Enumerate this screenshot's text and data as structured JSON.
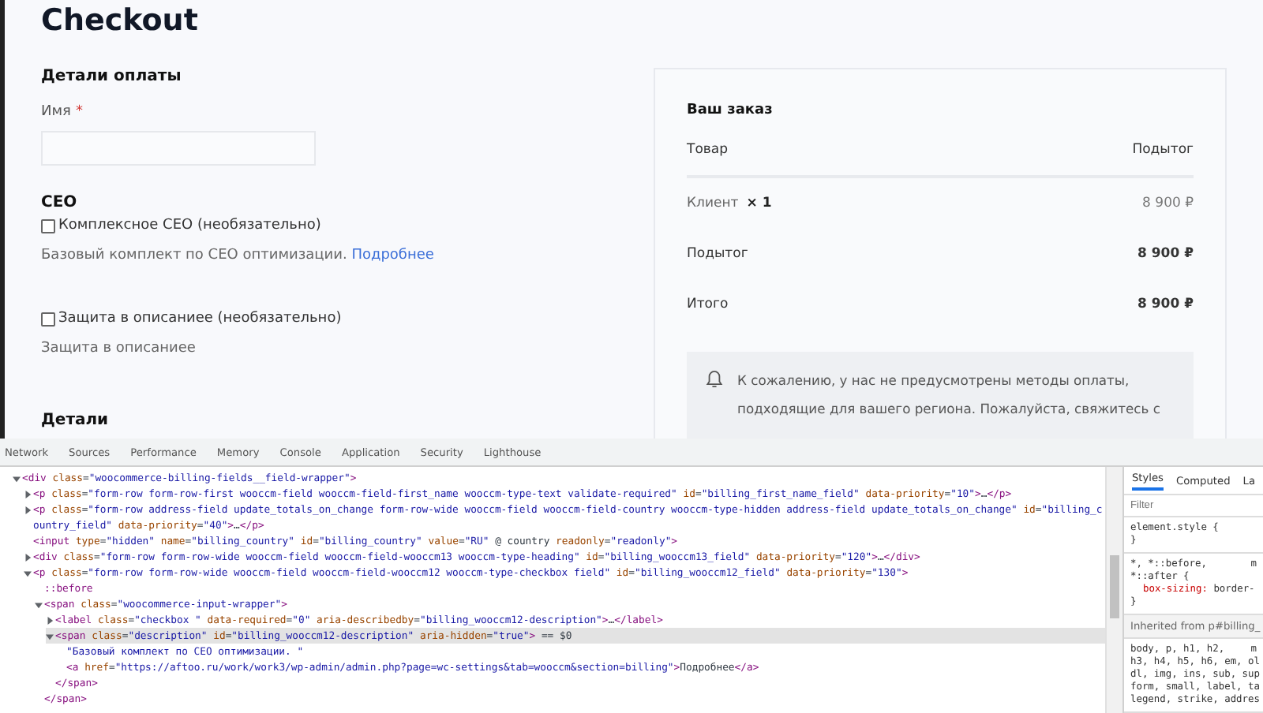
{
  "page": {
    "title": "Checkout",
    "billing": {
      "heading": "Детали оплаты",
      "name_field": {
        "label": "Имя",
        "required_mark": "*"
      },
      "seo_heading": "СЕО",
      "options": [
        {
          "label": "Комплексное СЕО (необязательно)",
          "checked": false,
          "description": "Базовый комплект по СЕО оптимизации.",
          "link": "Подробнее"
        },
        {
          "label": "Защита в описаниее (необязательно)",
          "checked": false,
          "description": "Защита в описаниее"
        }
      ],
      "details_heading": "Детали"
    },
    "order": {
      "heading": "Ваш заказ",
      "columns": [
        "Товар",
        "Подытог"
      ],
      "items": [
        {
          "name": "Клиент",
          "quantity": "× 1",
          "total": "8 900 ₽"
        }
      ],
      "totals": [
        {
          "label": "Подытог",
          "value": "8 900 ₽"
        },
        {
          "label": "Итого",
          "value": "8 900 ₽"
        }
      ],
      "notice": "К сожалению, у нас не предусмотрены методы оплаты, подходящие для вашего региона. Пожалуйста, свяжитесь с"
    }
  },
  "devtools": {
    "tabs": [
      {
        "label": "Network",
        "selected": false
      },
      {
        "label": "Sources",
        "selected": false
      },
      {
        "label": "Performance",
        "selected": false
      },
      {
        "label": "Memory",
        "selected": false
      },
      {
        "label": "Console",
        "selected": false
      },
      {
        "label": "Application",
        "selected": false
      },
      {
        "label": "Security",
        "selected": false
      },
      {
        "label": "Lighthouse",
        "selected": false
      }
    ],
    "elements": [
      {
        "kind": "node",
        "expanded": true,
        "selected": false,
        "text": "<div class=\"woocommerce-billing-fields__field-wrapper\">",
        "children": [
          {
            "kind": "node",
            "expanded": false,
            "selected": false,
            "text": "<p class=\"form-row form-row-first wooccm-field wooccm-field-first_name wooccm-type-text validate-required\" id=\"billing_first_name_field\" data-priority=\"10\">…</p>"
          },
          {
            "kind": "node",
            "expanded": false,
            "selected": false,
            "text": "<p class=\"form-row address-field update_totals_on_change form-row-wide wooccm-field wooccm-field-country wooccm-type-hidden address-field update_totals_on_change\" id=\"billing_country_field\" data-priority=\"40\">…</p>"
          },
          {
            "kind": "line",
            "selected": false,
            "text": "<input type=\"hidden\" name=\"billing_country\" id=\"billing_country\" value=\"RU\" @ country readonly=\"readonly\">"
          },
          {
            "kind": "node",
            "expanded": false,
            "selected": false,
            "text": "<div class=\"form-row form-row-wide wooccm-field wooccm-field-wooccm13 wooccm-type-heading\" id=\"billing_wooccm13_field\" data-priority=\"120\">…</div>"
          },
          {
            "kind": "node",
            "expanded": true,
            "selected": false,
            "text": "<p class=\"form-row form-row-wide wooccm-field wooccm-field-wooccm12 wooccm-type-checkbox field\" id=\"billing_wooccm12_field\" data-priority=\"130\">",
            "children": [
              {
                "kind": "line",
                "selected": false,
                "text": "::before"
              },
              {
                "kind": "node",
                "expanded": true,
                "selected": false,
                "text": "<span class=\"woocommerce-input-wrapper\">",
                "children": [
                  {
                    "kind": "node",
                    "expanded": false,
                    "selected": false,
                    "text": "<label class=\"checkbox \" data-required=\"0\" aria-describedby=\"billing_wooccm12-description\">…</label>"
                  },
                  {
                    "kind": "node",
                    "expanded": true,
                    "selected": true,
                    "text": "<span class=\"description\" id=\"billing_wooccm12-description\" aria-hidden=\"true\"> == $0",
                    "children": [
                      {
                        "kind": "line",
                        "selected": false,
                        "text": "\"Базовый комплект по СЕО оптимизации. \""
                      },
                      {
                        "kind": "line",
                        "selected": false,
                        "text": "<a href=\"https://aftoo.ru/work/work3/wp-admin/admin.php?page=wc-settings&tab=wooccm&section=billing\">Подробнее</a>"
                      }
                    ]
                  },
                  {
                    "kind": "line",
                    "selected": false,
                    "text": "</span>"
                  }
                ]
              },
              {
                "kind": "line",
                "selected": false,
                "text": "</span>"
              }
            ]
          }
        ]
      }
    ],
    "styles": {
      "tabs": [
        {
          "label": "Styles",
          "selected": true
        },
        {
          "label": "Computed",
          "selected": false
        },
        {
          "label": "La",
          "selected": false
        }
      ],
      "filter": {
        "placeholder": "Filter"
      },
      "blocks": [
        {
          "kind": "rule",
          "selector_lines": [
            "element.style {"
          ],
          "close": "}"
        },
        {
          "kind": "rule",
          "selector_lines": [
            "*, *::before,",
            "*::after {"
          ],
          "source": "m",
          "declarations": [
            {
              "property": "box-sizing:",
              "value": "border-"
            }
          ],
          "close": "}"
        },
        {
          "kind": "inherited",
          "text": "Inherited from p#billing_"
        },
        {
          "kind": "rule",
          "selector_lines": [
            "body, p, h1, h2,",
            "h3, h4, h5, h6, em, ol",
            "dl, img, ins, sub, sup",
            "form, small, label, ta",
            "legend, strike, addres"
          ],
          "source": "m"
        }
      ]
    }
  }
}
